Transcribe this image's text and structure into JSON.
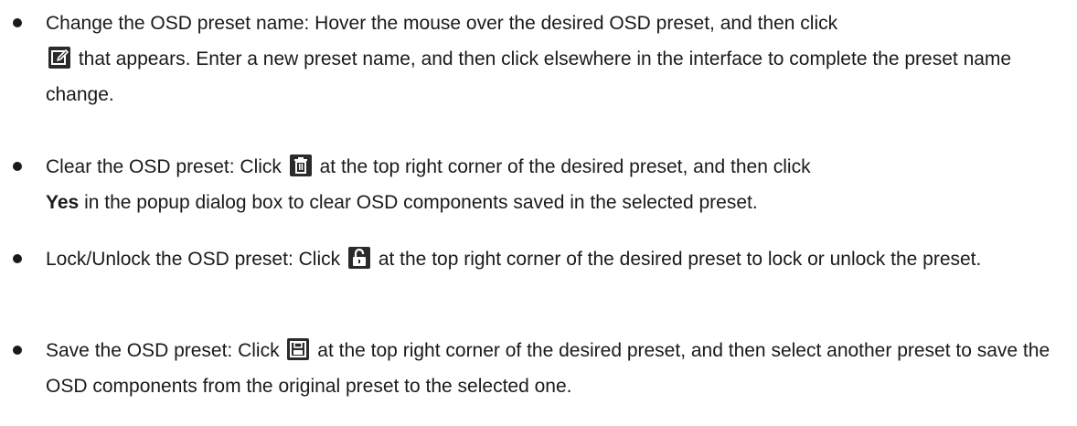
{
  "items": [
    {
      "part1": "Change the OSD preset name: Hover the mouse over the desired OSD preset, and then click",
      "icon": "edit-icon",
      "part2": "that appears. Enter a new preset name, and then click elsewhere in the interface to complete the preset name change."
    },
    {
      "part1": "Clear the OSD preset: Click",
      "icon": "trash-icon",
      "part2": "at the top right corner of the desired preset, and then click",
      "bold": "Yes",
      "part3": "in the popup dialog box to clear OSD components saved in the selected preset."
    },
    {
      "part1": "Lock/Unlock the OSD preset: Click",
      "icon": "unlock-icon",
      "part2": "at the top right corner of the desired preset to lock or unlock the preset."
    },
    {
      "part1": "Save the OSD preset: Click",
      "icon": "save-icon",
      "part2": "at the top right corner of the desired preset, and then select another preset to save the OSD components from the original preset to the selected one."
    }
  ],
  "colors": {
    "text": "#1a1a1a",
    "icon_bg": "#2b2b2b",
    "icon_fg": "#ffffff"
  }
}
